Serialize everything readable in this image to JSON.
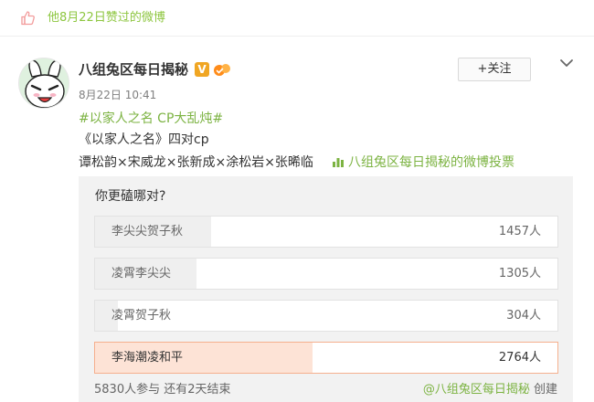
{
  "liked_bar": {
    "text": "他8月22日赞过的微博",
    "accent": "#8dc63f"
  },
  "post": {
    "author": "八组兔区每日揭秘",
    "verified_badge": "V",
    "time": "8月22日 10:41",
    "follow_label": "+关注",
    "hashtag": "#以家人之名 CP大乱炖#",
    "line2": "《以家人之名》四对cp",
    "line3": "谭松韵×宋威龙×张新成×涂松岩×张晞临",
    "poll_link": "八组兔区每日揭秘的微博投票"
  },
  "poll": {
    "question": "你更磕哪对?",
    "total_votes": 5830,
    "options": [
      {
        "label": "李尖尖贺子秋",
        "count": "1457人",
        "votes": 1457,
        "share": 0.25
      },
      {
        "label": "凌霄李尖尖",
        "count": "1305人",
        "votes": 1305,
        "share": 0.22
      },
      {
        "label": "凌霄贺子秋",
        "count": "304人",
        "votes": 304,
        "share": 0.05
      },
      {
        "label": "李海潮凌和平",
        "count": "2764人",
        "votes": 2764,
        "share": 0.47
      }
    ],
    "footer_left": "5830人参与  还有2天结束",
    "footer_creator": "@八组兔区每日揭秘",
    "footer_suffix": " 创建",
    "highlight_color": "#fde3d6",
    "bar_color": "#efefef"
  },
  "icons": {
    "thumb": "thumbs-up-icon",
    "vbadge": "verified-v-icon",
    "member": "member-icon",
    "chevron": "chevron-down-icon",
    "chart": "poll-chart-icon"
  }
}
